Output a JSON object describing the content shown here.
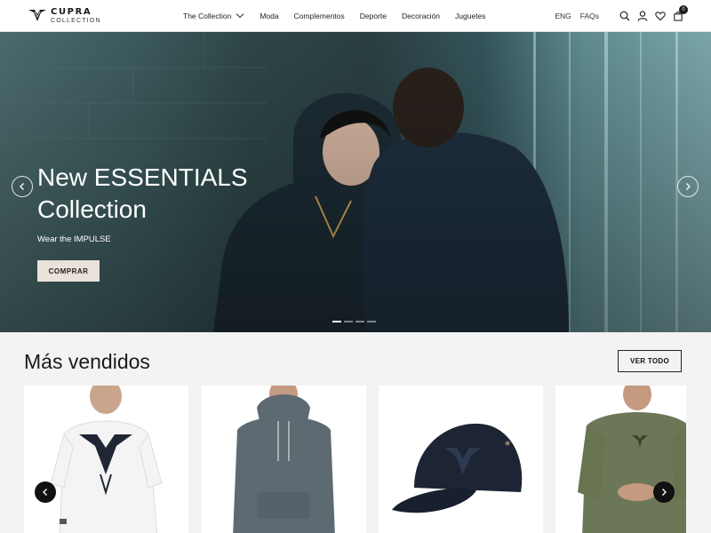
{
  "header": {
    "logo": {
      "word": "CUPRA",
      "sub": "COLLECTION"
    },
    "nav": [
      "The Collection",
      "Moda",
      "Complementos",
      "Deporte",
      "Decoración",
      "Juguetes"
    ],
    "language": "ENG",
    "faqs": "FAQs",
    "cart_count": "0",
    "icons": [
      "search-icon",
      "account-icon",
      "wishlist-heart-icon",
      "cart-bag-icon"
    ]
  },
  "hero": {
    "title_line1": "New ESSENTIALS",
    "title_line2": "Collection",
    "subtitle": "Wear the IMPULSE",
    "cta": "COMPRAR",
    "slides": 4,
    "active_slide": 1
  },
  "best_sellers": {
    "title": "Más vendidos",
    "see_all": "VER TODO",
    "products": [
      {
        "image": "white-t-shirt-cupra-logo"
      },
      {
        "image": "grey-hoodie"
      },
      {
        "image": "navy-cap-cupra-logo"
      },
      {
        "image": "olive-sweatshirt"
      }
    ]
  },
  "colors": {
    "accent_button": "#e9e1da",
    "text_dark": "#1a1a1a",
    "hero_teal": "#3d5b5d"
  }
}
